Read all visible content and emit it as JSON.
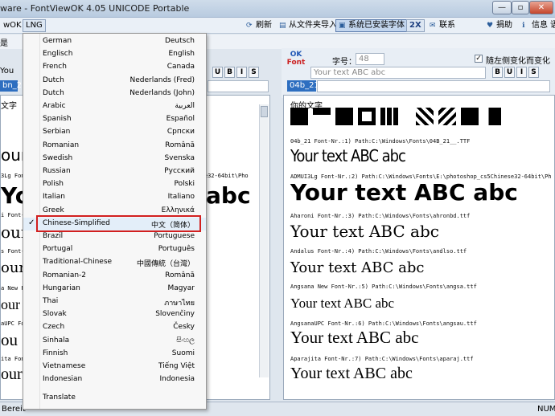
{
  "window": {
    "title": "ware - FontViewOK 4.05 UNICODE Portable",
    "btn_min": "—",
    "btn_max": "▫",
    "btn_close": "✕"
  },
  "toolbar": {
    "left_label": "wOK",
    "lng_label": "LNG",
    "refresh_label": "刷新",
    "import_label": "从文件夹导入",
    "installed_label": "系统已安装字体",
    "zoom_label": "2X",
    "contact_label": "联系",
    "donate_label": "捐助",
    "info_label": "信息",
    "lang_short": "语"
  },
  "toolbar2": {
    "left_label": "是",
    "left_frag": "You"
  },
  "right_panel": {
    "logo_line1": "OK",
    "logo_line2": "Font",
    "font_size_label": "字号：",
    "font_size_value": "48",
    "follow_left_label": "随左侧变化而变化",
    "text_input": "Your text ABC abc",
    "selected_font": "04b_21",
    "section_label": "你的文字"
  },
  "left_panel": {
    "selected_font": "bn_21",
    "section_label": "文字"
  },
  "samples": [
    {
      "meta": "04b_21 Font-Nr.:1) Path:C:\\Windows\\Fonts\\04B_21__.TTF",
      "text": "Your text ABC abc"
    },
    {
      "meta": "ADMUI3Lg Font-Nr.:2) Path:C:\\Windows\\Fonts\\E:\\photoshop_cs5Chinese32-64bit\\Ph",
      "text": "Your text ABC abc"
    },
    {
      "meta": "Aharoni Font-Nr.:3) Path:C:\\Windows\\Fonts\\ahronbd.ttf",
      "text": "Your text ABC abc"
    },
    {
      "meta": "Andalus Font-Nr.:4) Path:C:\\Windows\\Fonts\\andlso.ttf",
      "text": "Your text ABC abc"
    },
    {
      "meta": "Angsana New Font-Nr.:5) Path:C:\\Windows\\Fonts\\angsa.ttf",
      "text": "Your text ABC abc"
    },
    {
      "meta": "AngsanaUPC Font-Nr.:6) Path:C:\\Windows\\Fonts\\angsau.ttf",
      "text": "Your text ABC abc"
    },
    {
      "meta": "Aparajita Font-Nr.:7) Path:C:\\Windows\\Fonts\\aparaj.ttf",
      "text": "Your text ABC abc"
    }
  ],
  "left_fragments": [
    "our",
    "3Lg Font-Nr.:2) Path:C:\\Windows\\Fonts\\E:\\photoshop_cs5Chinese32-64bit\\Pho",
    "You",
    "abc",
    "i Font-Nr.:3) P",
    "our",
    "s Font-Nr.:4) P",
    "our",
    "a New Font-Nr.:5",
    "our",
    "aUPC Font-Nr.:6)",
    "ou",
    "ita Font-Nr.:7)",
    "our"
  ],
  "language_menu": [
    {
      "en": "German",
      "native": "Deutsch"
    },
    {
      "en": "Englisch",
      "native": "English"
    },
    {
      "en": "French",
      "native": "Canada"
    },
    {
      "en": "Dutch",
      "native": "Nederlands (Fred)"
    },
    {
      "en": "Dutch",
      "native": "Nederlands (John)"
    },
    {
      "en": "Arabic",
      "native": "العربية"
    },
    {
      "en": "Spanish",
      "native": "Español"
    },
    {
      "en": "Serbian",
      "native": "Српски"
    },
    {
      "en": "Romanian",
      "native": "Română"
    },
    {
      "en": "Swedish",
      "native": "Svenska"
    },
    {
      "en": "Russian",
      "native": "Русский"
    },
    {
      "en": "Polish",
      "native": "Polski"
    },
    {
      "en": "Italian",
      "native": "Italiano"
    },
    {
      "en": "Greek",
      "native": "Ελληνικά"
    },
    {
      "en": "Chinese-Simplified",
      "native": "中文（简体）",
      "selected": true
    },
    {
      "en": "Brazil",
      "native": "Portuguese"
    },
    {
      "en": "Portugal",
      "native": "Português"
    },
    {
      "en": "Traditional-Chinese",
      "native": "中國傳統（台灣）"
    },
    {
      "en": "Romanian-2",
      "native": "Română"
    },
    {
      "en": "Hungarian",
      "native": "Magyar"
    },
    {
      "en": "Thai",
      "native": "ภาษาไทย"
    },
    {
      "en": "Slovak",
      "native": "Slovenčiny"
    },
    {
      "en": "Czech",
      "native": "Česky"
    },
    {
      "en": "Sinhala",
      "native": "සිංහල"
    },
    {
      "en": "Finnish",
      "native": "Suomi"
    },
    {
      "en": "Vietnamese",
      "native": "Tiếng Việt"
    },
    {
      "en": "Indonesian",
      "native": "Indonesia"
    }
  ],
  "menu_translate": "Translate",
  "menu_check": "✓",
  "status": {
    "left": "Bereit",
    "right": "NUM"
  },
  "colors": {
    "highlight_border": "#d21f1f",
    "selection": "#2d6ec0"
  }
}
